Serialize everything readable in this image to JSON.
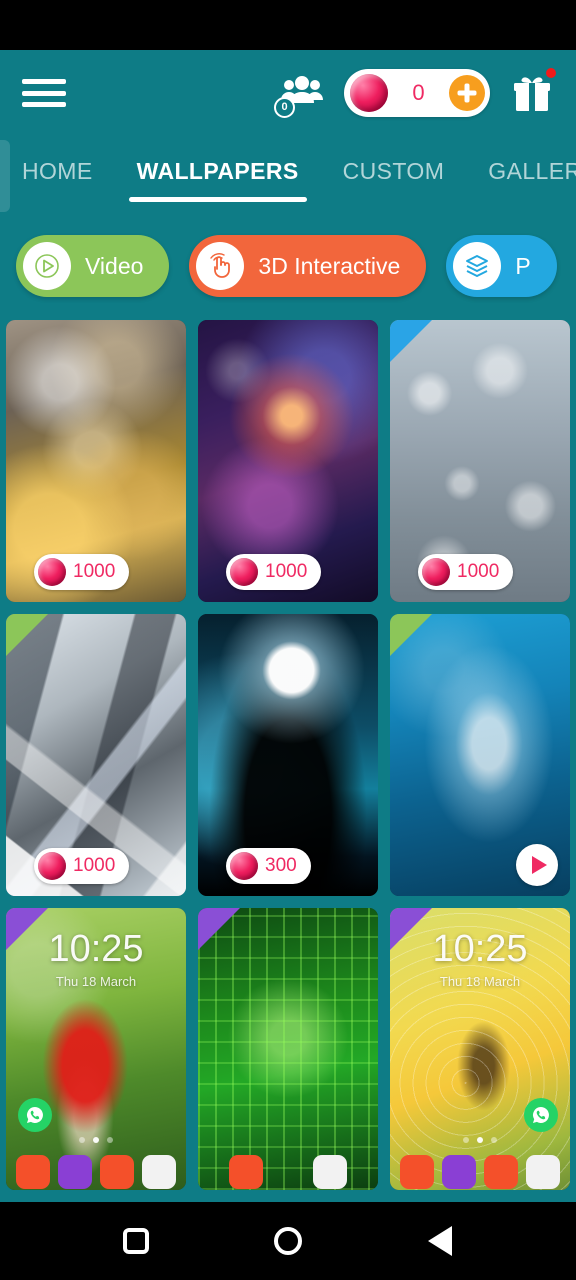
{
  "statusbar": {
    "present": true
  },
  "header": {
    "menu_icon": "hamburger-menu-icon",
    "friends_icon": "people-group-icon",
    "friends_count": "0",
    "gem_icon": "gem-icon",
    "gem_balance": "0",
    "add_icon": "plus-icon",
    "gift_icon": "gift-icon",
    "gift_has_notification": true
  },
  "tabs": [
    {
      "label": "HOME",
      "active": false
    },
    {
      "label": "WALLPAPERS",
      "active": true
    },
    {
      "label": "CUSTOM",
      "active": false
    },
    {
      "label": "GALLERY",
      "active": false
    }
  ],
  "filters": [
    {
      "label": "Video",
      "icon": "play-icon",
      "color": "#8cc659"
    },
    {
      "label": "3D Interactive",
      "icon": "touch-hand-icon",
      "color": "#f2663c"
    },
    {
      "label": "P",
      "icon": "layers-icon",
      "color": "#23a8e0"
    }
  ],
  "wallpapers": [
    {
      "name": "clockwork-gears",
      "art": "art-gears",
      "ribbon": null,
      "price": "1000",
      "play": false,
      "lock": false
    },
    {
      "name": "galaxy-nebula",
      "art": "art-galaxy",
      "ribbon": null,
      "price": "1000",
      "play": false,
      "lock": false
    },
    {
      "name": "rain-window",
      "art": "art-rain",
      "ribbon": "blue",
      "price": "1000",
      "play": false,
      "lock": false
    },
    {
      "name": "diamond-crystal",
      "art": "art-diamond",
      "ribbon": "green",
      "price": "1000",
      "play": false,
      "lock": false
    },
    {
      "name": "moonlit-tree",
      "art": "art-moon",
      "ribbon": null,
      "price": "300",
      "play": false,
      "lock": false
    },
    {
      "name": "shark-underwater",
      "art": "art-shark",
      "ribbon": "green",
      "price": null,
      "play": true,
      "lock": false
    },
    {
      "name": "mushroom-theme",
      "art": "art-mushroom",
      "ribbon": "purple",
      "price": null,
      "play": false,
      "lock": true
    },
    {
      "name": "circuit-theme",
      "art": "art-circuit",
      "ribbon": "purple",
      "price": null,
      "play": false,
      "lock": false
    },
    {
      "name": "spider-web-theme",
      "art": "art-spider",
      "ribbon": "purple",
      "price": null,
      "play": false,
      "lock": true
    }
  ],
  "lockscreen": {
    "time": "10:25",
    "date": "Thu 18 March",
    "whatsapp_icon": "whatsapp-icon"
  },
  "navbar": [
    {
      "name": "recents-button",
      "icon": "square-icon"
    },
    {
      "name": "home-button",
      "icon": "circle-icon"
    },
    {
      "name": "back-button",
      "icon": "triangle-back-icon"
    }
  ],
  "colors": {
    "background": "#0e7c86",
    "accent_pink": "#ef2a63",
    "accent_orange": "#f79e1e",
    "video_green": "#8cc659",
    "interactive_orange": "#f2663c",
    "parallax_blue": "#23a8e0"
  }
}
